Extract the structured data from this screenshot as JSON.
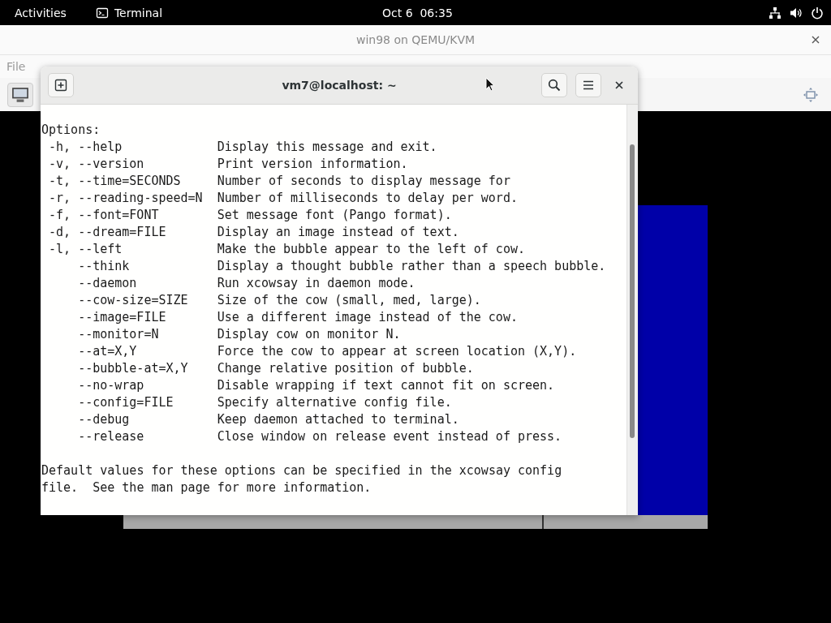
{
  "top_bar": {
    "activities": "Activities",
    "app": "Terminal",
    "clock": "Oct 6  06:35"
  },
  "vm_window": {
    "title": "win98 on QEMU/KVM",
    "menu": [
      "File"
    ]
  },
  "terminal": {
    "title": "vm7@localhost: ~",
    "heading": "Options:",
    "options": [
      {
        "short": "-h,",
        "long": "--help",
        "description": "Display this message and exit."
      },
      {
        "short": "-v,",
        "long": "--version",
        "description": "Print version information."
      },
      {
        "short": "-t,",
        "long": "--time=SECONDS",
        "description": "Number of seconds to display message for"
      },
      {
        "short": "-r,",
        "long": "--reading-speed=N",
        "description": "Number of milliseconds to delay per word."
      },
      {
        "short": "-f,",
        "long": "--font=FONT",
        "description": "Set message font (Pango format)."
      },
      {
        "short": "-d,",
        "long": "--dream=FILE",
        "description": "Display an image instead of text."
      },
      {
        "short": "-l,",
        "long": "--left",
        "description": "Make the bubble appear to the left of cow."
      },
      {
        "long": "--think",
        "description": "Display a thought bubble rather than a speech bubble."
      },
      {
        "long": "--daemon",
        "description": "Run xcowsay in daemon mode."
      },
      {
        "long": "--cow-size=SIZE",
        "description": "Size of the cow (small, med, large)."
      },
      {
        "long": "--image=FILE",
        "description": "Use a different image instead of the cow."
      },
      {
        "long": "--monitor=N",
        "description": "Display cow on monitor N."
      },
      {
        "long": "--at=X,Y",
        "description": "Force the cow to appear at screen location (X,Y)."
      },
      {
        "long": "--bubble-at=X,Y",
        "description": "Change relative position of bubble."
      },
      {
        "long": "--no-wrap",
        "description": "Disable wrapping if text cannot fit on screen."
      },
      {
        "long": "--config=FILE",
        "description": "Specify alternative config file."
      },
      {
        "long": "--debug",
        "description": "Keep daemon attached to terminal."
      },
      {
        "long": "--release",
        "description": "Close window on release event instead of press."
      }
    ],
    "footer": [
      "Default values for these options can be specified in the xcowsay config",
      "file.  See the man page for more information."
    ]
  }
}
